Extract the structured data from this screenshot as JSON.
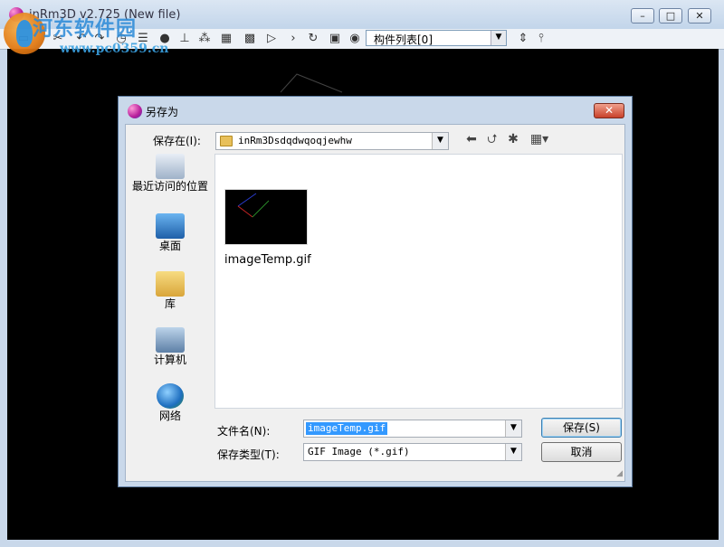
{
  "main_window": {
    "title": "inRm3D v2.725 (New file)",
    "watermark": "河东软件园",
    "watermark_url": "www.pc0359.cn",
    "minimize": "–",
    "maximize": "□",
    "close": "✕",
    "component_list": "构件列表[0]"
  },
  "dialog": {
    "title": "另存为",
    "close": "✕",
    "save_in_label": "保存在(I):",
    "save_in_value": "inRm3Dsdqdwqoqjewhw",
    "places": [
      {
        "label": "最近访问的位置"
      },
      {
        "label": "桌面"
      },
      {
        "label": "库"
      },
      {
        "label": "计算机"
      },
      {
        "label": "网络"
      }
    ],
    "files": [
      {
        "name": "imageTemp.gif"
      }
    ],
    "filename_label": "文件名(N):",
    "filename_value": "imageTemp.gif",
    "filetype_label": "保存类型(T):",
    "filetype_value": "GIF Image (*.gif)",
    "save_button": "保存(S)",
    "cancel_button": "取消"
  }
}
